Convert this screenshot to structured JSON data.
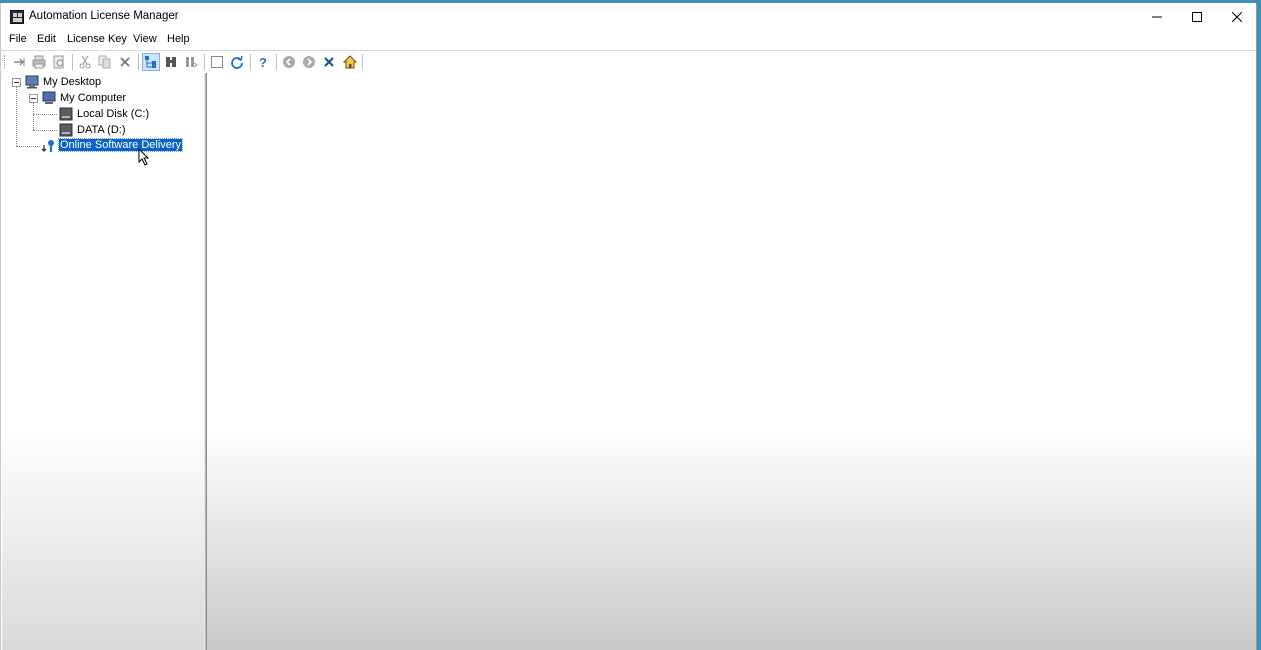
{
  "window": {
    "title": "Automation License Manager",
    "controls": {
      "minimize": "minimize",
      "maximize": "maximize",
      "close": "close"
    }
  },
  "menu": [
    "File",
    "Edit",
    "License Key",
    "View",
    "Help"
  ],
  "toolbar_icons": [
    "transfer-icon",
    "print-icon",
    "print-preview-icon",
    "cut-icon",
    "copy-icon",
    "delete-icon",
    "tree-view-icon",
    "find-icon",
    "find-next-icon",
    "select-all-icon",
    "refresh-icon",
    "help-icon",
    "back-icon",
    "forward-icon",
    "stop-icon",
    "home-icon"
  ],
  "tree": {
    "root": {
      "label": "My Desktop",
      "icon": "desktop-icon"
    },
    "computer": {
      "label": "My Computer",
      "icon": "computer-icon"
    },
    "drives": [
      {
        "label": "Local Disk (C:)",
        "icon": "drive-icon"
      },
      {
        "label": "DATA (D:)",
        "icon": "drive-icon"
      }
    ],
    "delivery": {
      "label": "Online Software Delivery",
      "icon": "key-icon",
      "selected": true
    }
  },
  "colors": {
    "selection": "#0a64c8",
    "desktop_background": "#3f8fb6",
    "accent_icon": "#1e6fd0"
  }
}
